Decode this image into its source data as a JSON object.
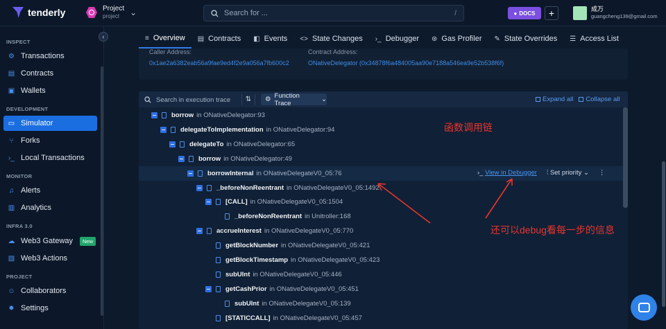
{
  "app": {
    "name": "tenderly"
  },
  "project": {
    "name": "Project",
    "sub": "project"
  },
  "search": {
    "placeholder": "Search for ...",
    "shortcut": "/"
  },
  "header": {
    "docs_label": "DOCS",
    "plus": "+",
    "user_name": "成万",
    "user_email": "guangcheng139@gmail.com"
  },
  "sidebar": {
    "sections": {
      "inspect": "INSPECT",
      "development": "DEVELOPMENT",
      "monitor": "MONITOR",
      "infra": "INFRA 3.0",
      "project": "PROJECT"
    },
    "items": {
      "transactions": "Transactions",
      "contracts": "Contracts",
      "wallets": "Wallets",
      "simulator": "Simulator",
      "forks": "Forks",
      "local_tx": "Local Transactions",
      "alerts": "Alerts",
      "analytics": "Analytics",
      "web3_gateway": "Web3 Gateway",
      "new_badge": "New",
      "web3_actions": "Web3 Actions",
      "collaborators": "Collaborators",
      "settings": "Settings"
    },
    "collapse_glyph": "‹"
  },
  "tabs": [
    "Overview",
    "Contracts",
    "Events",
    "State Changes",
    "Debugger",
    "Gas Profiler",
    "State Overrides",
    "Access List"
  ],
  "info": {
    "caller_label": "Caller Address:",
    "caller_value": "0x1ae2a6382eab56a9fae9ed4f2e9a056a7fb600c2",
    "contract_label": "Contract Address:",
    "contract_value": "ONativeDelegator (0x34878f6a484005aa90e7188a546ea9e52b538f6f)"
  },
  "trace_toolbar": {
    "search_placeholder": "Search in execution trace",
    "mode": "Function Trace",
    "expand_all": "Expand all",
    "collapse_all": "Collapse all"
  },
  "trace_rows": [
    {
      "fn": "borrow",
      "loc": "in ONativeDelegator:93",
      "depth": 0,
      "toggle": true
    },
    {
      "fn": "delegateToImplementation",
      "loc": "in ONativeDelegator:94",
      "depth": 1,
      "toggle": true
    },
    {
      "fn": "delegateTo",
      "loc": "in ONativeDelegator:65",
      "depth": 2,
      "toggle": true
    },
    {
      "fn": "borrow",
      "loc": "in ONativeDelegator:49",
      "depth": 3,
      "toggle": true
    },
    {
      "fn": "borrowInternal",
      "loc": "in ONativeDelegateV0_05:76",
      "depth": 4,
      "toggle": true
    },
    {
      "fn": "_beforeNonReentrant",
      "loc": "in ONativeDelegateV0_05:1492",
      "depth": 5,
      "toggle": true
    },
    {
      "fn": "[CALL]",
      "loc": "in ONativeDelegateV0_05:1504",
      "depth": 6,
      "toggle": true
    },
    {
      "fn": "_beforeNonReentrant",
      "loc": "in Unitroller:168",
      "depth": 7,
      "toggle": false
    },
    {
      "fn": "accrueInterest",
      "loc": "in ONativeDelegateV0_05:770",
      "depth": 5,
      "toggle": true
    },
    {
      "fn": "getBlockNumber",
      "loc": "in ONativeDelegateV0_05:421",
      "depth": 6,
      "toggle": false
    },
    {
      "fn": "getBlockTimestamp",
      "loc": "in ONativeDelegateV0_05:423",
      "depth": 6,
      "toggle": false
    },
    {
      "fn": "subUInt",
      "loc": "in ONativeDelegateV0_05:446",
      "depth": 6,
      "toggle": false
    },
    {
      "fn": "getCashPrior",
      "loc": "in ONativeDelegateV0_05:451",
      "depth": 6,
      "toggle": true
    },
    {
      "fn": "subUInt",
      "loc": "in ONativeDelegateV0_05:139",
      "depth": 7,
      "toggle": false
    },
    {
      "fn": "[STATICCALL]",
      "loc": "in ONativeDelegateV0_05:457",
      "depth": 6,
      "toggle": false
    }
  ],
  "row_actions": {
    "view_debugger": "View in Debugger",
    "set_priority": "Set priority",
    "more": "⋮"
  },
  "annotations": {
    "call_chain": "函数调用链",
    "debug_note": "还可以debug看每一步的信息"
  },
  "colors": {
    "accent": "#1b6ee0",
    "annotation": "#e8352e",
    "background": "#0d1a2c"
  }
}
